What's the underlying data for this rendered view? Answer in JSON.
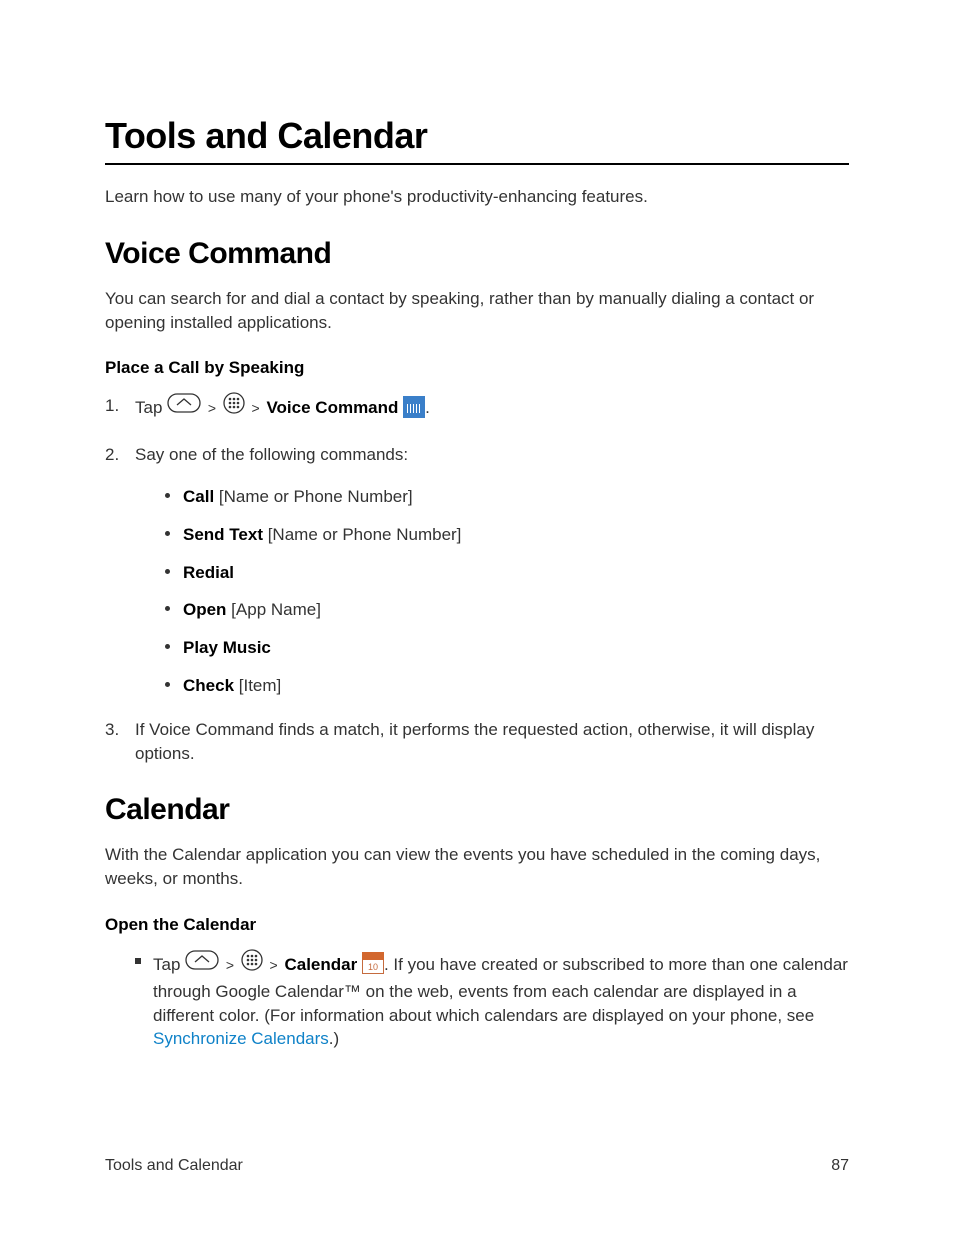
{
  "title": "Tools and Calendar",
  "intro": "Learn how to use many of your phone's productivity-enhancing features.",
  "voice": {
    "heading": "Voice Command",
    "intro": "You can search for and dial a contact by speaking, rather than by manually dialing a contact or opening installed applications.",
    "sub": "Place a Call by Speaking",
    "step1_tap": "Tap",
    "step1_vc": "Voice Command",
    "step2": "Say one of the following commands:",
    "cmds": [
      {
        "b": "Call",
        "t": " [Name or Phone Number]"
      },
      {
        "b": "Send Text",
        "t": " [Name or Phone Number]"
      },
      {
        "b": "Redial",
        "t": ""
      },
      {
        "b": "Open",
        "t": " [App Name]"
      },
      {
        "b": "Play Music",
        "t": ""
      },
      {
        "b": "Check",
        "t": " [Item]"
      }
    ],
    "step3": "If Voice Command finds a match, it performs the requested action, otherwise, it will display options."
  },
  "cal": {
    "heading": "Calendar",
    "intro": "With the Calendar application you can view the events you have scheduled in the coming days, weeks, or months.",
    "sub": "Open the Calendar",
    "tap": "Tap",
    "cal_label": "Calendar",
    "rest": ". If you have created or subscribed to more than one calendar through Google Calendar™ on the web, events from each calendar are displayed in a different color. (For information about which calendars are displayed on your phone, see ",
    "link": "Synchronize Calendars",
    "after_link": ".)"
  },
  "footer": {
    "left": "Tools and Calendar",
    "right": "87"
  },
  "gt": ">"
}
